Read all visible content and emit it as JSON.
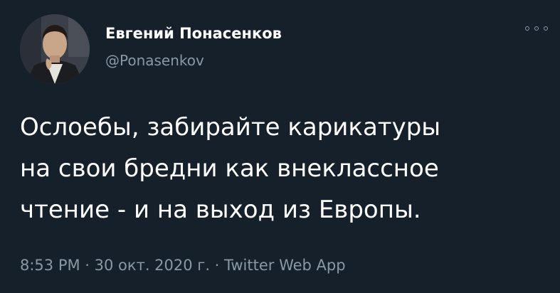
{
  "author": {
    "display_name": "Евгений Понасенков",
    "handle": "@Ponasenkov"
  },
  "tweet": {
    "lines": [
      "Ослоебы, забирайте карикатуры",
      "на свои бредни как внеклассное",
      "чтение - и на выход из Европы."
    ]
  },
  "meta": {
    "time": "8:53 PM",
    "separator": " · ",
    "date": "30 окт. 2020 г.",
    "source": "Twitter Web App"
  },
  "colors": {
    "background": "#15202b",
    "text": "#ffffff",
    "secondary": "#8899a6"
  },
  "icons": {
    "more": "more-options-icon"
  }
}
